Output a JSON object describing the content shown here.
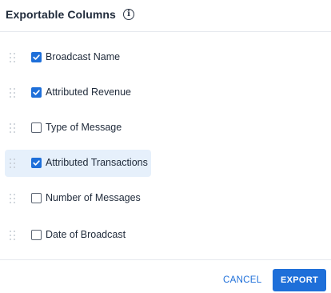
{
  "header": {
    "title": "Exportable Columns",
    "info_icon": "info-icon"
  },
  "columns": [
    {
      "label": "Broadcast Name",
      "checked": true,
      "highlighted": false
    },
    {
      "label": "Attributed Revenue",
      "checked": true,
      "highlighted": false
    },
    {
      "label": "Type of Message",
      "checked": false,
      "highlighted": false
    },
    {
      "label": "Attributed Transactions",
      "checked": true,
      "highlighted": true
    },
    {
      "label": "Number of Messages",
      "checked": false,
      "highlighted": false
    },
    {
      "label": "Date of Broadcast",
      "checked": false,
      "highlighted": false
    }
  ],
  "footer": {
    "cancel_label": "CANCEL",
    "export_label": "EXPORT"
  },
  "colors": {
    "accent": "#1e6fd9",
    "highlight_bg": "#e6f0fb",
    "text": "#1f2a3a",
    "divider": "#e6e9ee"
  }
}
